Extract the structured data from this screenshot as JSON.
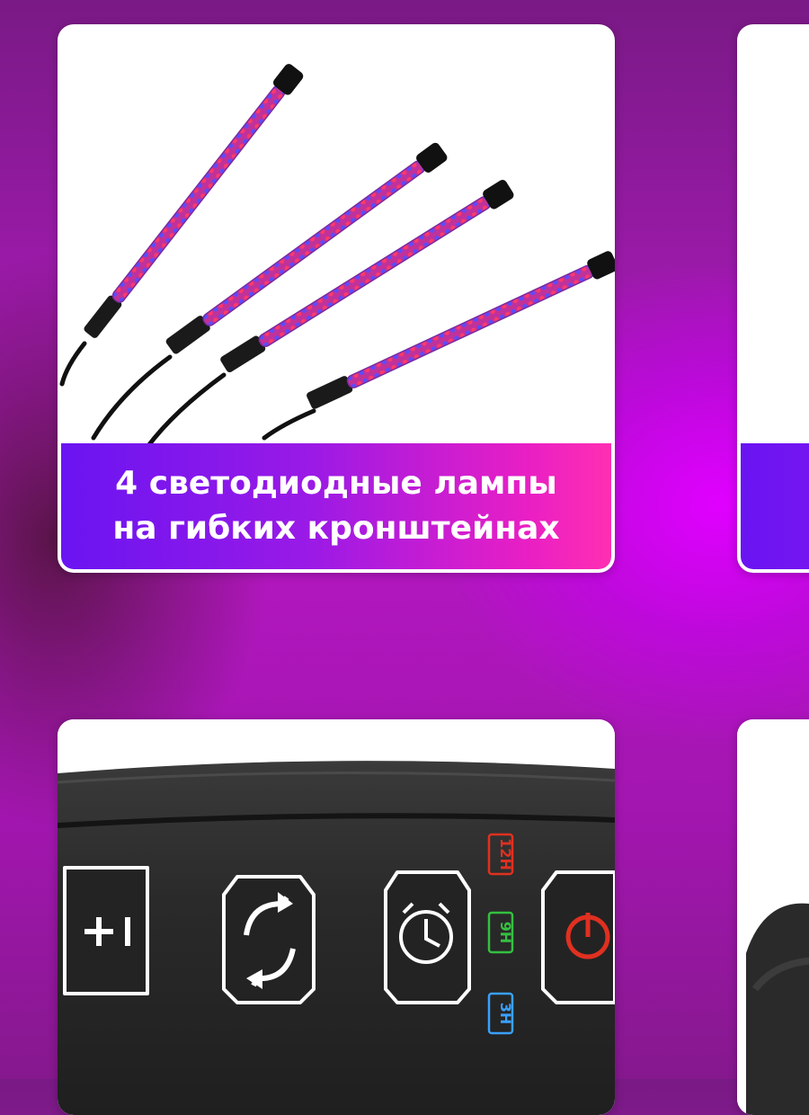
{
  "cards": [
    {
      "image_icon": "led-grow-lamps",
      "caption_lines": [
        "4 светодиодные лампы",
        "на гибких кронштейнах"
      ]
    },
    {
      "image_icon": "partial-card"
    },
    {
      "image_icon": "control-panel",
      "panel_labels": {
        "timer_12h": "12H",
        "timer_9h": "9H",
        "timer_3h": "3H"
      }
    },
    {
      "image_icon": "partial-card-photo"
    }
  ],
  "colors": {
    "accent_purple": "#6a14f2",
    "accent_pink": "#ff2fb2",
    "background_magenta": "#b317c0"
  }
}
